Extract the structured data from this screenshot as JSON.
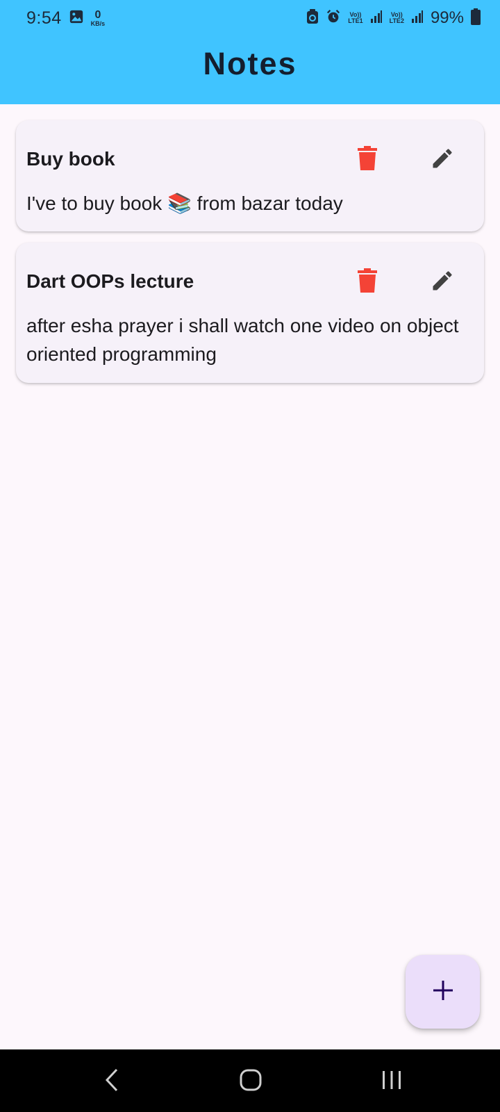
{
  "status_bar": {
    "time": "9:54",
    "speed_value": "0",
    "speed_unit": "KB/s",
    "sim1": {
      "top": "Vo))",
      "bottom": "LTE1"
    },
    "sim2": {
      "top": "Vo))",
      "bottom": "LTE2"
    },
    "battery": "99%"
  },
  "app_bar": {
    "title": "Notes"
  },
  "notes": [
    {
      "title": "Buy book",
      "body": "I've to buy book 📚 from bazar today"
    },
    {
      "title": "Dart OOPs lecture",
      "body": "after esha prayer i shall watch one video on object oriented programming"
    }
  ],
  "icons": {
    "delete": "trash-icon",
    "edit": "pencil-icon",
    "add": "plus-icon",
    "nav_back": "chevron-left-icon",
    "nav_home": "home-icon",
    "nav_recents": "recents-icon"
  },
  "colors": {
    "app_bar": "#40c4ff",
    "background": "#fdf7fc",
    "card": "#f6f1f9",
    "delete": "#f44336",
    "edit": "#424242",
    "fab": "#ebdefa",
    "fab_icon": "#21005d"
  }
}
